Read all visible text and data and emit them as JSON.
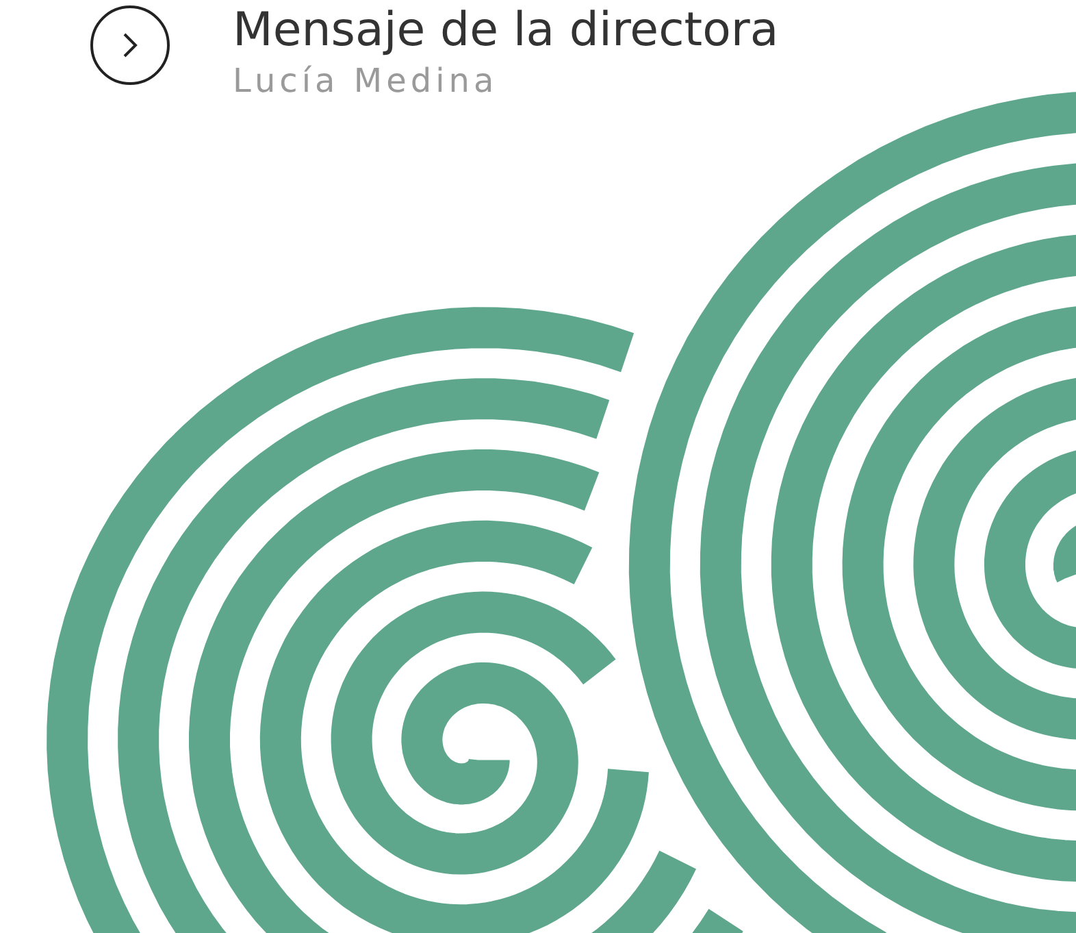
{
  "heading": {
    "title": "Mensaje de la directora",
    "author": "Lucía Medina"
  }
}
